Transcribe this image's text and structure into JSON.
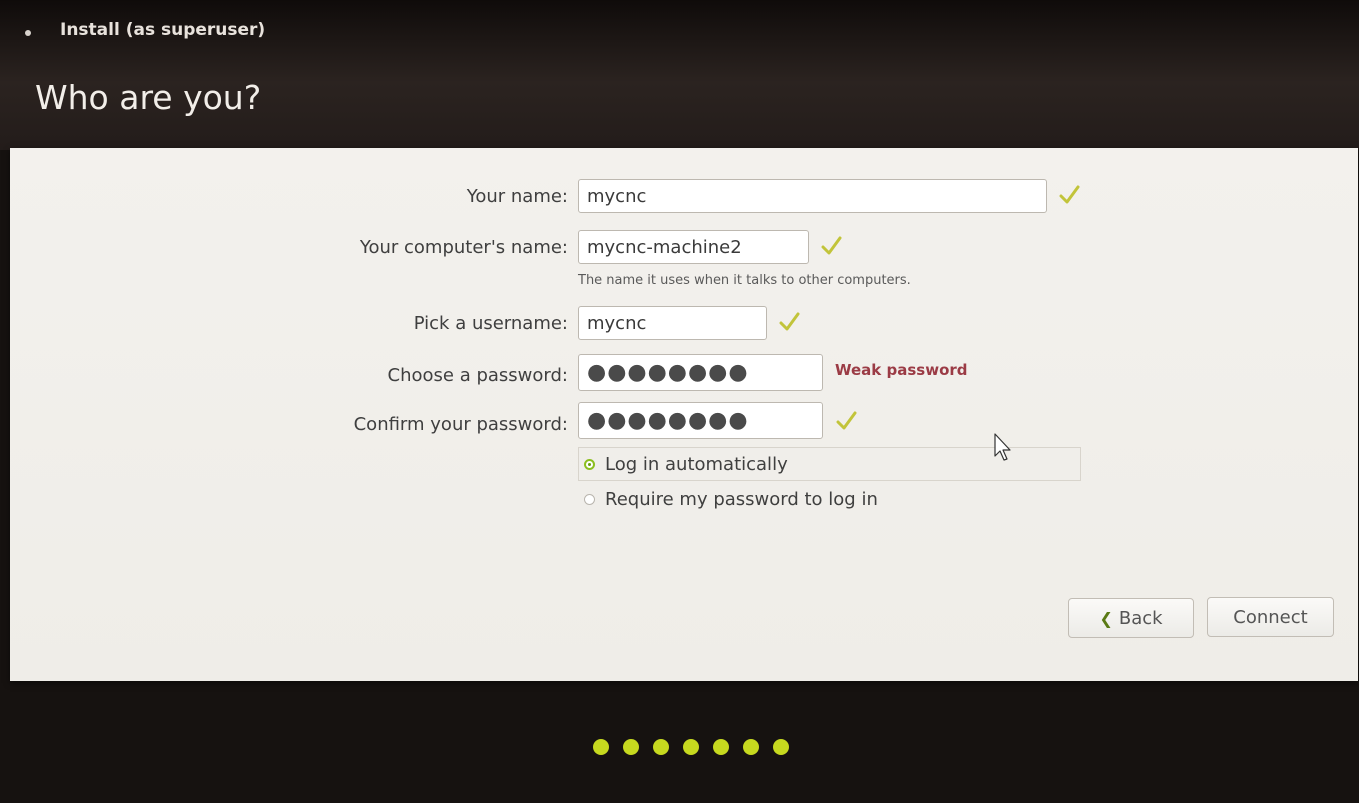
{
  "window": {
    "title": "Install (as superuser)",
    "heading": "Who are you?"
  },
  "form": {
    "name_label": "Your name:",
    "name_value": "mycnc",
    "computer_label": "Your computer's name:",
    "computer_value": "mycnc-machine2",
    "computer_hint": "The name it uses when it talks to other computers.",
    "username_label": "Pick a username:",
    "username_value": "mycnc",
    "password_label": "Choose a password:",
    "password_value": "●●●●●●●●",
    "password_strength": "Weak password",
    "confirm_label": "Confirm your password:",
    "confirm_value": "●●●●●●●●",
    "login_options": [
      {
        "label": "Log in automatically",
        "selected": true
      },
      {
        "label": "Require my password to log in",
        "selected": false
      }
    ]
  },
  "buttons": {
    "back_label": "Back",
    "back_icon": "chevron-left-icon",
    "connect_label": "Connect"
  },
  "progress": {
    "steps": 7,
    "current": 7
  },
  "colors": {
    "accent": "#8cbf1f",
    "check": "#c2c43a",
    "weak": "#9b3b45",
    "progress_dot": "#c6d91f"
  }
}
